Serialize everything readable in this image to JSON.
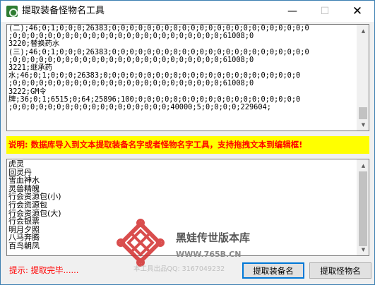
{
  "window": {
    "title": "提取装备怪物名工具",
    "minimize_glyph": "—",
    "maximize_glyph": "☐",
    "close_glyph": "✕"
  },
  "source_box": {
    "lines": [
      "(二);46;0;1;0;0;0;26383;0;0;0;0;0;0;0;0;0;0;0;0;0;0;0;0;0;0;0;0;0;0;0",
      ";0;0;0;0;0;0;0;0;0;0;0;0;0;0;0;0;0;0;0;0;0;0;0;0;61008;0",
      "3220;替换药水",
      "(三);46;0;1;0;0;0;26383;0;0;0;0;0;0;0;0;0;0;0;0;0;0;0;0;0;0;0;0;0;0;0",
      ";0;0;0;0;0;0;0;0;0;0;0;0;0;0;0;0;0;0;0;0;0;0;0;0;61008;0",
      "3221;继承药",
      "水;46;0;1;0;0;0;26383;0;0;0;0;0;0;0;0;0;0;0;0;0;0;0;0;0;0;0;0;0;0;0",
      ";0;0;0;0;0;0;0;0;0;0;0;0;0;0;0;0;0;0;0;0;0;0;0;0;61008;0",
      "3222;GM令",
      "牌;36;0;1;6515;0;64;25896;100;0;0;0;0;0;0;0;0;0;0;0;0;0;0;0;0;0;0;0",
      ";0;0;0;0;0;0;0;0;0;0;0;0;0;0;0;0;0;0;40000;5;0;0;0;0;229604;"
    ]
  },
  "hint": {
    "text": "说明:  数据库导入到文本提取装备名字或者怪物名字工具，支持拖拽文本到编辑框!"
  },
  "result_box": {
    "items": [
      "虎灵",
      "回灵丹",
      "雪血神水",
      "灵兽精魄",
      "行会资源包(小)",
      "行会资源包",
      "行会资源包(大)",
      "行会银票",
      "明月夕照",
      "八马奔腾",
      "百鸟朝凤"
    ]
  },
  "status": {
    "text": "提示: 提取完毕......"
  },
  "buttons": {
    "extract_equipment": "提取装备名",
    "extract_monster": "提取怪物名"
  },
  "watermark": {
    "site_name": "黑娃传世版本库",
    "url": "WWW.765B.CN",
    "qq_line": "本工具出品QQ: 3167049232"
  },
  "colors": {
    "hint_background": "#ffff00",
    "hint_text": "#ff0000",
    "status_text": "#ff0000",
    "logo_red": "#d32f2f",
    "button_focus_border": "#0078d7"
  },
  "icons": {
    "app": "app-icon",
    "scroll_up": "scroll-up-arrow-icon",
    "scroll_down": "scroll-down-arrow-icon",
    "watermark_logo": "endless-knot-logo-icon"
  }
}
